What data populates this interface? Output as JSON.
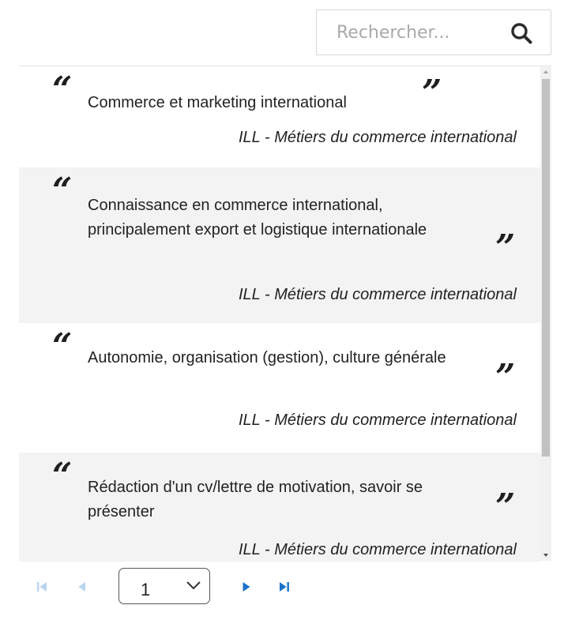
{
  "search": {
    "placeholder": "Rechercher...",
    "icon": "search-icon"
  },
  "quotes": {
    "items": [
      {
        "text": "Commerce et marketing international",
        "author": "ILL - Métiers du commerce international"
      },
      {
        "text": "Connaissance en commerce international, principalement export et logistique internationale",
        "author": "ILL - Métiers du commerce international"
      },
      {
        "text": "Autonomie, organisation (gestion), culture générale",
        "author": "ILL - Métiers du commerce international"
      },
      {
        "text": "Rédaction d'un cv/lettre de motivation, savoir se présenter",
        "author": "ILL - Métiers du commerce international"
      }
    ]
  },
  "pager": {
    "current_page": "1",
    "icons": {
      "first": "first-page-icon",
      "prev": "previous-page-icon",
      "next": "next-page-icon",
      "last": "last-page-icon",
      "dropdown": "chevron-down-icon"
    }
  },
  "colors": {
    "accent": "#1a73c9",
    "disabled": "#b8d4ee",
    "alt_row": "#f3f3f3",
    "text": "#222222"
  }
}
